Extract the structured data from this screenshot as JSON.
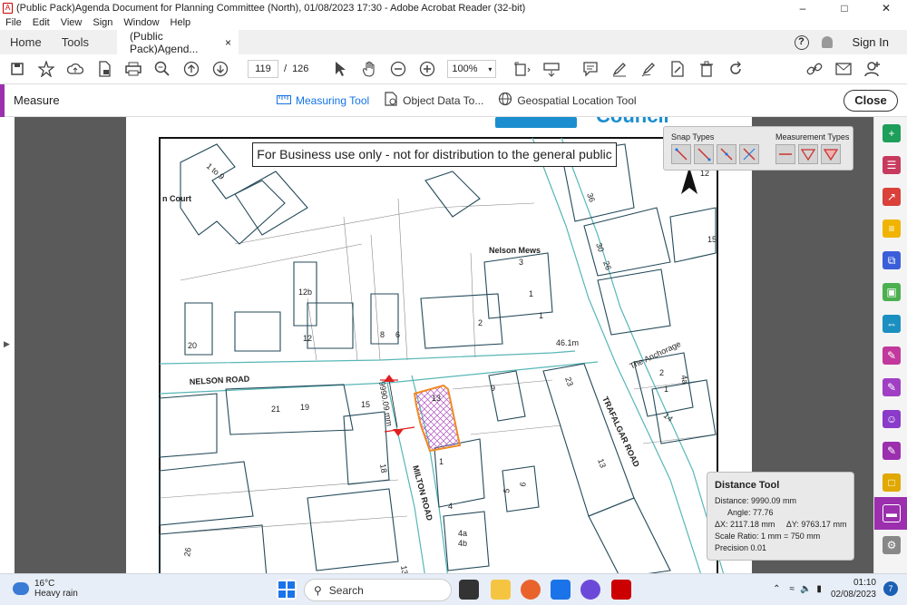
{
  "window": {
    "title": "(Public Pack)Agenda Document for Planning Committee (North), 01/08/2023 17:30 - Adobe Acrobat Reader (32-bit)",
    "minimize": "–",
    "maximize": "□",
    "close": "✕"
  },
  "menu": [
    "File",
    "Edit",
    "View",
    "Sign",
    "Window",
    "Help"
  ],
  "tabs": {
    "home": "Home",
    "tools": "Tools",
    "doc_tab": "(Public Pack)Agend...",
    "doc_close": "×",
    "help": "?",
    "signin": "Sign In"
  },
  "toolbar": {
    "page_current": "119",
    "page_sep": "/",
    "page_total": "126",
    "zoom": "100%"
  },
  "measure": {
    "title": "Measure",
    "measuring_tool": "Measuring Tool",
    "object_data": "Object Data To...",
    "geospatial": "Geospatial Location Tool",
    "close": "Close"
  },
  "map": {
    "banner": "For Business use only - not for distribution to the general public",
    "council_partial": "Council",
    "labels": {
      "one_to_nine": "1 to 9",
      "court": "n Court",
      "nelson_mews": "Nelson Mews",
      "twelve_b": "12b",
      "twelve": "12",
      "twenty": "20",
      "eight": "8",
      "six": "6",
      "two": "2",
      "three": "3",
      "one_a": "1",
      "one_b": "1",
      "thirty_six": "36",
      "thirty": "30",
      "twenty_six": "26",
      "fifteen_right": "15",
      "twelve_right": "12",
      "distance_461": "46.1m",
      "nelson_road": "NELSON ROAD",
      "the_anchorage": "The Anchorage",
      "two_r": "2",
      "four_a": "4a",
      "one_r": "1",
      "fourteen": "14",
      "twenty_three": "23",
      "trafalgar_road": "TRAFALGAR ROAD",
      "thirteen_site": "13",
      "nine": "9",
      "twenty_one": "21",
      "nineteen": "19",
      "fifteen": "15",
      "eighteen": "18",
      "milton_road": "MILTON ROAD",
      "one_m": "1",
      "four_m": "4",
      "five": "5",
      "six_m": "6",
      "four_a_m": "4a",
      "four_b": "4b",
      "thirteen_r": "13",
      "twenty_six_b": "26",
      "thirteen_b": "13",
      "measure_label": "9990.09 mm"
    }
  },
  "snap_panel": {
    "snap_types": "Snap Types",
    "measurement_types": "Measurement Types"
  },
  "distance_tool": {
    "title": "Distance Tool",
    "distance": "Distance: 9990.09 mm",
    "angle": "Angle: 77.76",
    "dx": "ΔX: 2117.18 mm",
    "dy": "ΔY: 9763.17 mm",
    "scale": "Scale Ratio: 1 mm = 750 mm",
    "precision": "Precision      0.01"
  },
  "taskbar": {
    "temp": "16°C",
    "condition": "Heavy rain",
    "search": "Search",
    "time": "01:10",
    "date": "02/08/2023",
    "notifications": "7"
  }
}
